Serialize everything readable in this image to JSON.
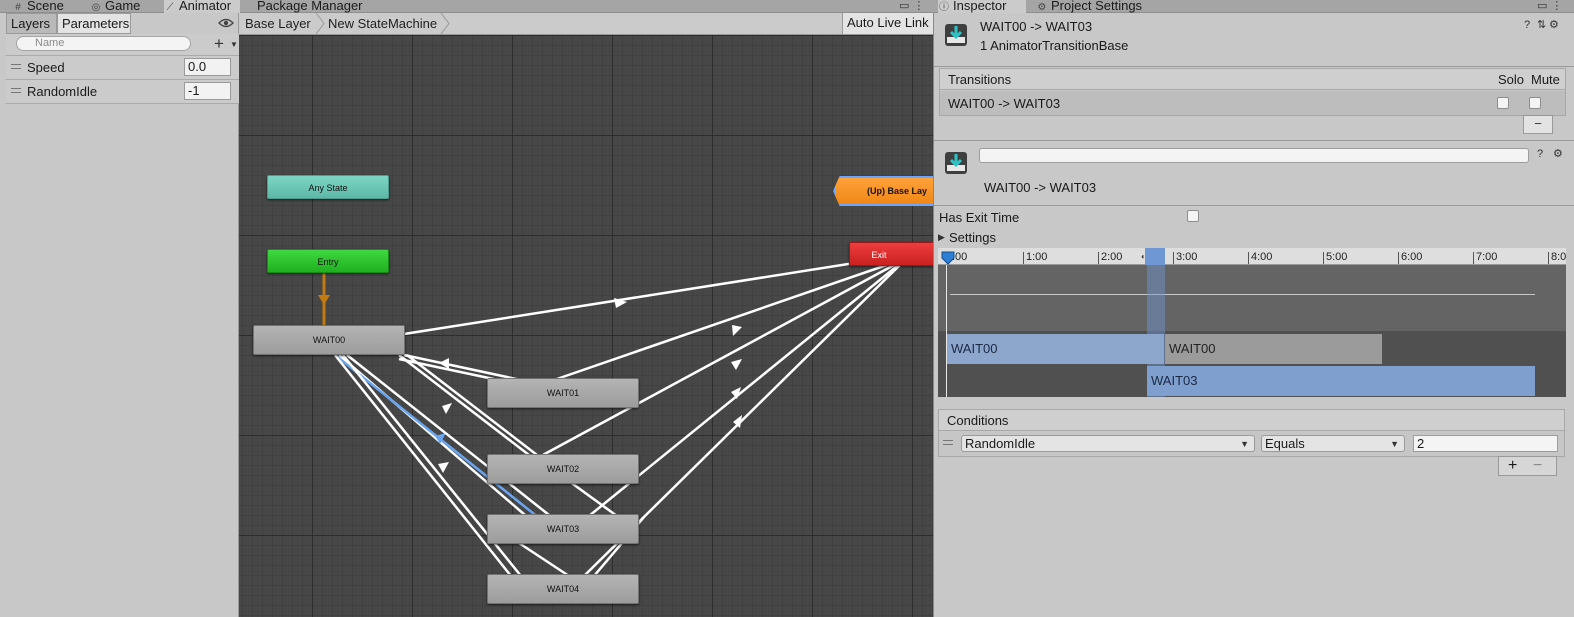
{
  "left_tabs": {
    "scene": "Scene",
    "game": "Game",
    "animator": "Animator",
    "package_manager": "Package Manager"
  },
  "right_tabs": {
    "inspector": "Inspector",
    "project_settings": "Project Settings"
  },
  "parameters_panel": {
    "tab_layers": "Layers",
    "tab_parameters": "Parameters",
    "search_placeholder": "Name",
    "params": [
      {
        "name": "Speed",
        "value": "0.0"
      },
      {
        "name": "RandomIdle",
        "value": "-1"
      }
    ]
  },
  "graph": {
    "breadcrumb": [
      "Base Layer",
      "New StateMachine"
    ],
    "auto_live_link": "Auto Live Link",
    "nodes": {
      "any_state": "Any State",
      "entry": "Entry",
      "exit": "Exit",
      "up_base_layer": "(Up) Base Lay",
      "wait00": "WAIT00",
      "wait01": "WAIT01",
      "wait02": "WAIT02",
      "wait03": "WAIT03",
      "wait04": "WAIT04"
    }
  },
  "inspector": {
    "title": "WAIT00 -> WAIT03",
    "subtitle": "1 AnimatorTransitionBase",
    "transitions_header": "Transitions",
    "solo_label": "Solo",
    "mute_label": "Mute",
    "transition_row": "WAIT00 -> WAIT03",
    "minus": "−",
    "transition_name_value": "",
    "transition_label": "WAIT00 -> WAIT03",
    "has_exit_time_label": "Has Exit Time",
    "has_exit_time": false,
    "settings_label": "Settings",
    "timeline_ticks": [
      ":00",
      "1:00",
      "2:00",
      "3:00",
      "4:00",
      "5:00",
      "6:00",
      "7:00",
      "8:0"
    ],
    "bars": {
      "source_a": "WAIT00",
      "source_b": "WAIT00",
      "destination": "WAIT03"
    },
    "conditions_header": "Conditions",
    "condition": {
      "parameter": "RandomIdle",
      "mode": "Equals",
      "value": "2"
    },
    "add_btn": "+",
    "remove_btn": "−"
  }
}
